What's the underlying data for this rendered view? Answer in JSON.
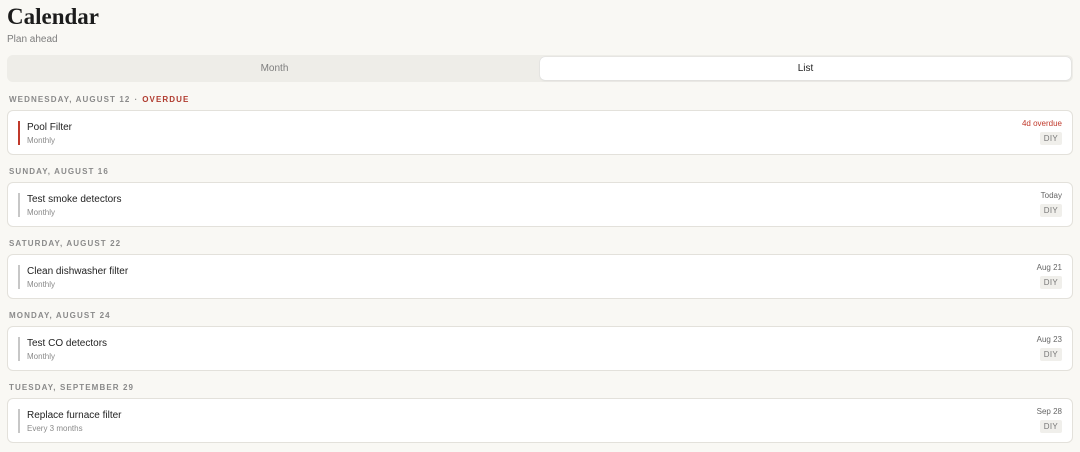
{
  "header": {
    "title": "Calendar",
    "subtitle": "Plan ahead"
  },
  "view_toggle": {
    "options": [
      "Month",
      "List"
    ],
    "selected": "List"
  },
  "groups": [
    {
      "date": "WEDNESDAY, AUGUST 12",
      "overdue_label": "OVERDUE",
      "item": {
        "name": "Pool Filter",
        "frequency": "Monthly",
        "due": "4d overdue",
        "tag": "DIY"
      }
    },
    {
      "date": "SUNDAY, AUGUST 16",
      "item": {
        "name": "Test smoke detectors",
        "frequency": "Monthly",
        "due": "Today",
        "tag": "DIY"
      }
    },
    {
      "date": "SATURDAY, AUGUST 22",
      "item": {
        "name": "Clean dishwasher filter",
        "frequency": "Monthly",
        "due": "Aug 21",
        "tag": "DIY"
      }
    },
    {
      "date": "MONDAY, AUGUST 24",
      "item": {
        "name": "Test CO detectors",
        "frequency": "Monthly",
        "due": "Aug 23",
        "tag": "DIY"
      }
    },
    {
      "date": "TUESDAY, SEPTEMBER 29",
      "item": {
        "name": "Replace furnace filter",
        "frequency": "Every 3 months",
        "due": "Sep 28",
        "tag": "DIY"
      }
    }
  ],
  "colors": {
    "overdue": "#c0392b",
    "background": "#f9f8f4"
  }
}
